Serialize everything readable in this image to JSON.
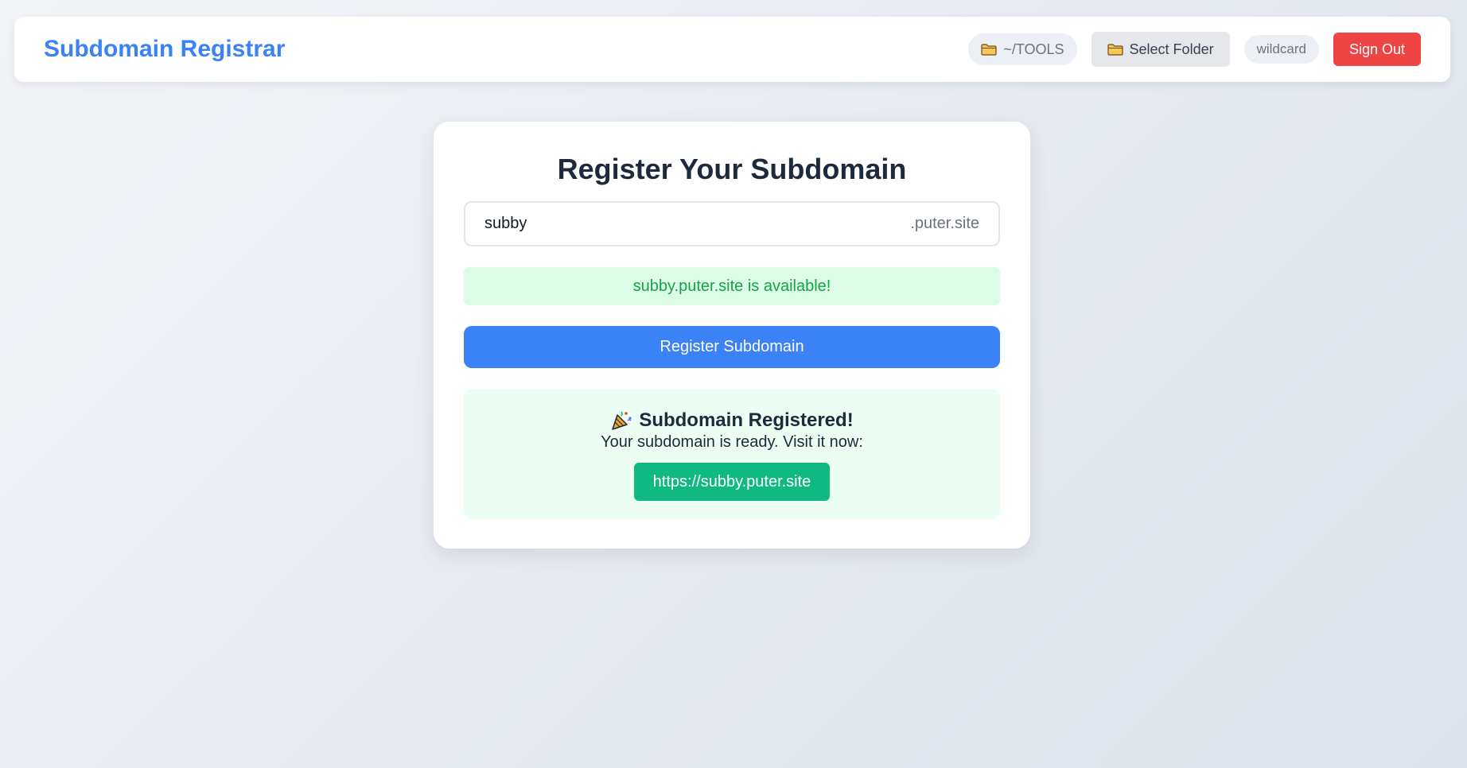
{
  "header": {
    "title": "Subdomain Registrar",
    "folder_path": "~/TOOLS",
    "select_folder_label": "Select Folder",
    "wildcard_label": "wildcard",
    "sign_out_label": "Sign Out"
  },
  "card": {
    "title": "Register Your Subdomain",
    "input_value": "subby",
    "suffix": ".puter.site",
    "availability_message": "subby.puter.site is available!",
    "register_button_label": "Register Subdomain"
  },
  "success": {
    "icon": "party-popper-icon",
    "title": "Subdomain Registered!",
    "subtitle": "Your subdomain is ready. Visit it now:",
    "link_label": "https://subby.puter.site"
  },
  "colors": {
    "accent": "#3b82f6",
    "danger": "#ef4444",
    "success": "#10b981",
    "success_text": "#16a34a"
  }
}
